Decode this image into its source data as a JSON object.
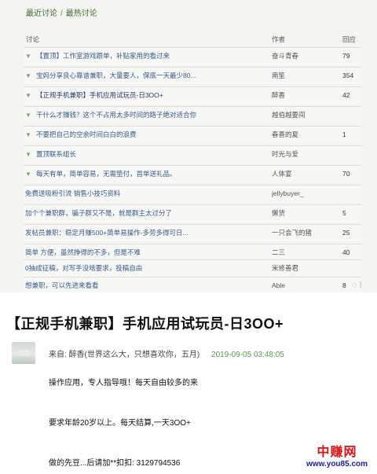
{
  "tabs": {
    "recent": "最近讨论",
    "separator": "/",
    "hot": "最热讨论"
  },
  "columns": {
    "topic": "讨论",
    "author": "作者",
    "replies": "回应"
  },
  "rows": [
    {
      "pin": "▼",
      "title": "【置顶】工作室游戏跟单，补贴家用的看过来",
      "author": "奋斗青春",
      "count": "79"
    },
    {
      "pin": "▼",
      "title": "宝妈分享良心靠谱兼职，大量要人，保底一天最少80...",
      "author": "南笙",
      "count": "354"
    },
    {
      "pin": "▼",
      "title": "【正规手机兼职】手机应用试玩员-日3OO+",
      "author": "醉香",
      "count": "42"
    },
    {
      "pin": "▼",
      "title": "干什么才赚钱？这个不占用太多时间的路子绝对适合你",
      "author": "越伯越要闯",
      "count": ""
    },
    {
      "pin": "▼",
      "title": "不要把自己的空余时间白白的浪费",
      "author": "春喜的夏",
      "count": "1"
    },
    {
      "pin": "▼",
      "title": "置顶联系组长",
      "author": "时光与爱",
      "count": ""
    },
    {
      "pin": "▼",
      "title": "每天有单，简单容易，无需垫付，首单送礼品。",
      "author": "人体宴",
      "count": "70"
    },
    {
      "pin": "",
      "title": "免费送吸粉引流 销售小技巧资料",
      "author": "jellybuyer_",
      "count": ""
    },
    {
      "pin": "",
      "title": "加个个兼职群，骗子群又不是，就是群主太过分了",
      "author": "懒货",
      "count": "5"
    },
    {
      "pin": "",
      "title": "发帖员兼职：稳定月赚500+简单易操作-多劳多得可日...",
      "author": "一只会飞的猪",
      "count": "25"
    },
    {
      "pin": "",
      "title": "简单 方便，虽然挣得的不多，但是不难",
      "author": "二三",
      "count": "40"
    },
    {
      "pin": "",
      "title": "0抽成征稿，对写手没啥要求，投稿自由",
      "author": "米修善君",
      "count": ""
    },
    {
      "pin": "",
      "title": "想兼职，可以先进来看看",
      "author": "Able",
      "count": "8"
    }
  ],
  "post": {
    "title": "【正规手机兼职】手机应用试玩员-日3OO+",
    "from_label": "来自:",
    "author": "醉香(世界这么大，只想喜欢你，五月)",
    "time": "2019-09-05 03:48:05",
    "lines": [
      "操作应用，专人指导哦！每天自由较多的来",
      "要求年龄20岁以上。每天结算,一天3OO+",
      "做的先豆...后请加**扣扣: 3129794536"
    ]
  },
  "watermark": {
    "name": "中赚网",
    "url": "www.you85.com"
  }
}
